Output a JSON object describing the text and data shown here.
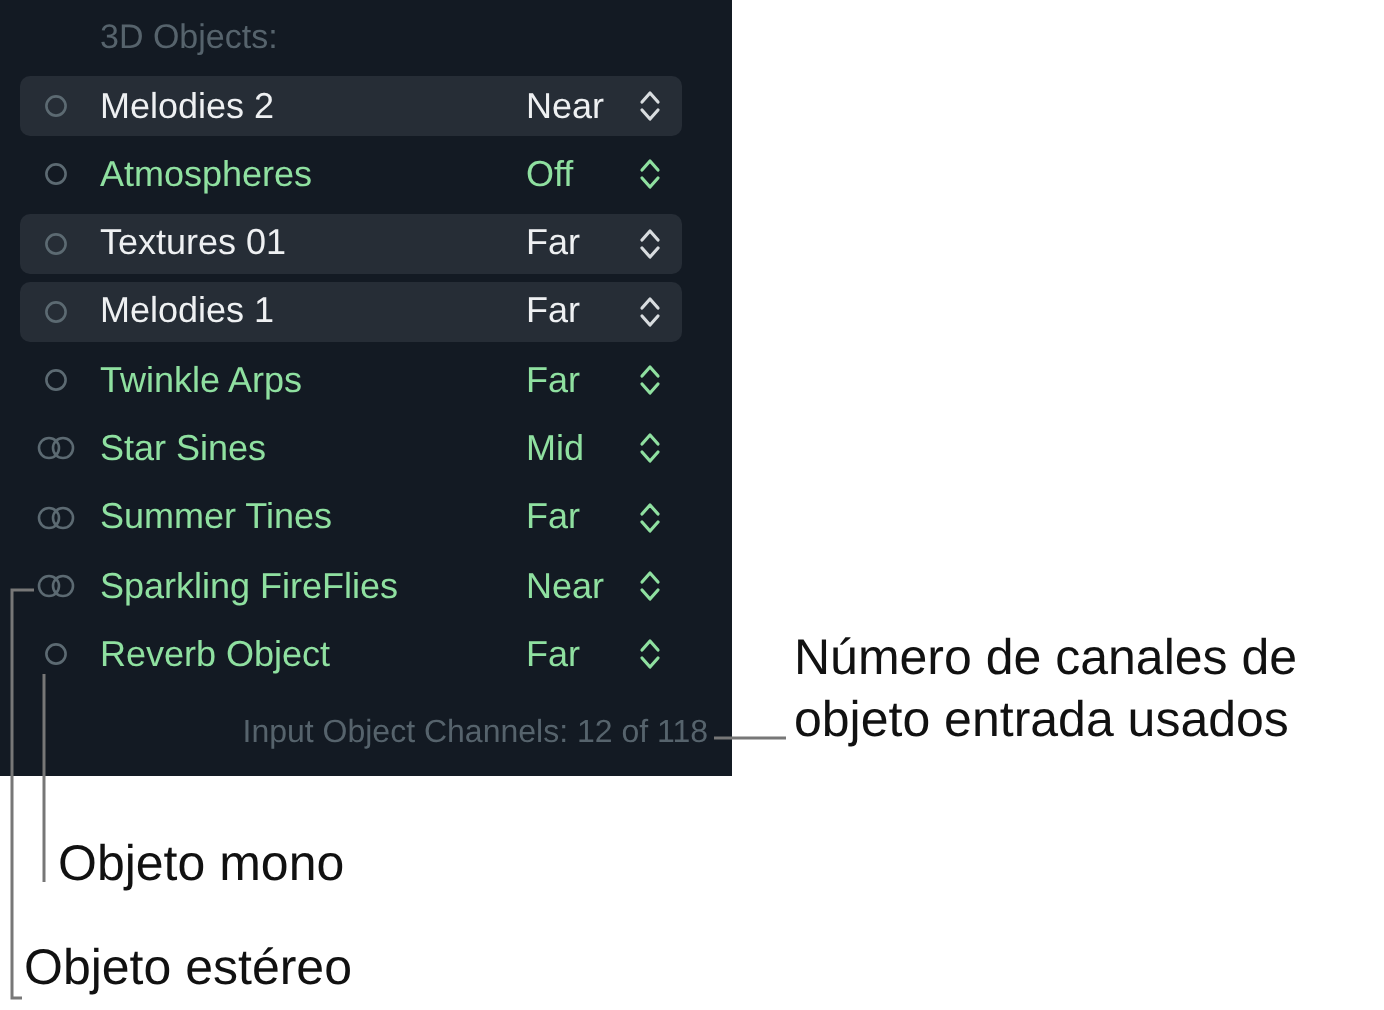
{
  "panel": {
    "title": "3D Objects:",
    "rows": [
      {
        "name": "Melodies 2",
        "value": "Near",
        "kind": "mono",
        "selected": true
      },
      {
        "name": "Atmospheres",
        "value": "Off",
        "kind": "mono",
        "selected": false
      },
      {
        "name": "Textures 01",
        "value": "Far",
        "kind": "mono",
        "selected": true
      },
      {
        "name": "Melodies 1",
        "value": "Far",
        "kind": "mono",
        "selected": true
      },
      {
        "name": "Twinkle Arps",
        "value": "Far",
        "kind": "mono",
        "selected": false
      },
      {
        "name": "Star Sines",
        "value": "Mid",
        "kind": "stereo",
        "selected": false
      },
      {
        "name": "Summer Tines",
        "value": "Far",
        "kind": "stereo",
        "selected": false
      },
      {
        "name": "Sparkling FireFlies",
        "value": "Near",
        "kind": "stereo",
        "selected": false
      },
      {
        "name": "Reverb Object",
        "value": "Far",
        "kind": "mono",
        "selected": false
      }
    ],
    "footer": "Input Object Channels: 12 of 118"
  },
  "callouts": {
    "channels": [
      "Número de canales de",
      "objeto entrada usados"
    ],
    "mono": "Objeto mono",
    "stereo": "Objeto estéreo"
  }
}
